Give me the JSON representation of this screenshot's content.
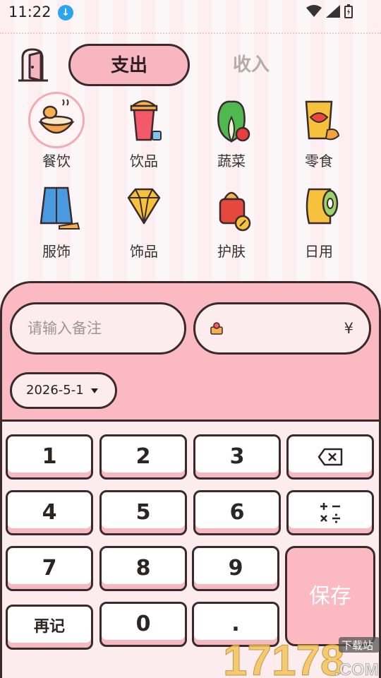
{
  "status_bar": {
    "time": "11:22"
  },
  "header": {
    "tabs": [
      {
        "label": "支出",
        "active": true
      },
      {
        "label": "收入",
        "active": false
      }
    ]
  },
  "categories": [
    {
      "label": "餐饮",
      "icon": "food-bowl-icon",
      "selected": true
    },
    {
      "label": "饮品",
      "icon": "drink-cup-icon",
      "selected": false
    },
    {
      "label": "蔬菜",
      "icon": "vegetable-icon",
      "selected": false
    },
    {
      "label": "零食",
      "icon": "snack-bag-icon",
      "selected": false
    },
    {
      "label": "服饰",
      "icon": "clothing-icon",
      "selected": false
    },
    {
      "label": "饰品",
      "icon": "diamond-icon",
      "selected": false
    },
    {
      "label": "护肤",
      "icon": "skincare-icon",
      "selected": false
    },
    {
      "label": "日用",
      "icon": "tissue-roll-icon",
      "selected": false
    }
  ],
  "form": {
    "note_placeholder": "请输入备注",
    "currency_symbol": "¥",
    "date": "2026-5-1"
  },
  "keypad": {
    "keys": [
      "1",
      "2",
      "3",
      "4",
      "5",
      "6",
      "7",
      "8",
      "9",
      "再记",
      "0",
      "."
    ],
    "save_label": "保存"
  },
  "watermark": {
    "text": "17178",
    "domain": ".COM",
    "tag": "下载站"
  },
  "colors": {
    "accent": "#fbb9c2",
    "outline": "#3a2a2c",
    "background": "#fdecee"
  }
}
